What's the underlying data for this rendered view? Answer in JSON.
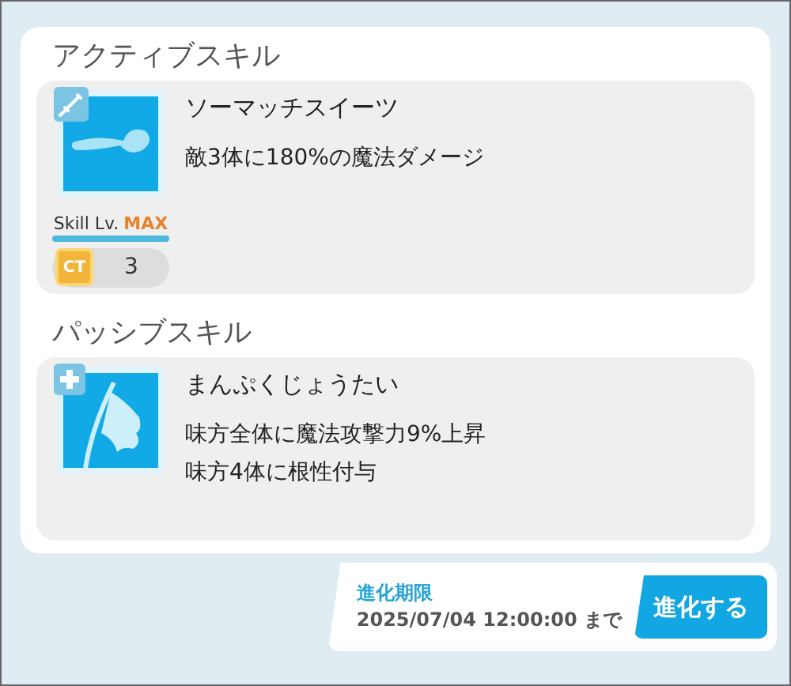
{
  "sections": [
    {
      "title": "アクティブスキル",
      "skill": {
        "kind": "active",
        "name": "ソーマッチスイーツ",
        "description": [
          "敵3体に180%の魔法ダメージ"
        ],
        "level_label": "Skill Lv.",
        "level_value": "MAX",
        "ct_label": "CT",
        "ct_value": "3"
      }
    },
    {
      "title": "パッシブスキル",
      "skill": {
        "kind": "passive",
        "name": "まんぷくじょうたい",
        "description": [
          "味方全体に魔法攻撃力9%上昇",
          "味方4体に根性付与"
        ]
      }
    }
  ],
  "evolution": {
    "label": "進化期限",
    "deadline": "2025/07/04 12:00:00 まで",
    "button": "進化する"
  }
}
